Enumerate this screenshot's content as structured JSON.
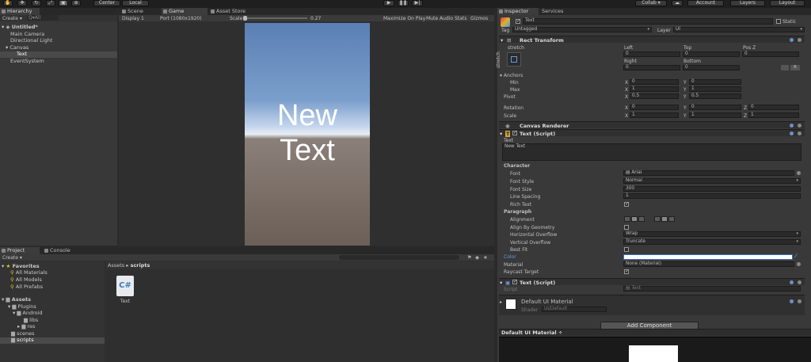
{
  "toolbar": {
    "center": "Center",
    "local": "Local",
    "collab": "Collab ▾",
    "account": "Account",
    "layers": "Layers",
    "layout": "Layout"
  },
  "hierarchy": {
    "tab": "Hierarchy",
    "create": "Create ▾",
    "search": "Q▾All",
    "scene": "Untitled*",
    "items": [
      "Main Camera",
      "Directional Light",
      "Canvas",
      "Text",
      "EventSystem"
    ]
  },
  "game": {
    "tabs": [
      "Scene",
      "Game",
      "Asset Store"
    ],
    "display": "Display 1",
    "resolution": "Port (1080x1920)",
    "scale_label": "Scale",
    "scale_value": "0.27",
    "options": [
      "Maximize On Play",
      "Mute Audio",
      "Stats",
      "Gizmos"
    ],
    "canvas_text_1": "New",
    "canvas_text_2": "Text"
  },
  "project": {
    "tabs": [
      "Project",
      "Console"
    ],
    "create": "Create ▾",
    "favorites": "Favorites",
    "fav_items": [
      "All Materials",
      "All Models",
      "All Prefabs"
    ],
    "assets": "Assets",
    "tree": [
      "Plugins",
      "Android",
      "libs",
      "res",
      "scenes",
      "scripts"
    ],
    "breadcrumb_root": "Assets",
    "breadcrumb_sep": "▸",
    "breadcrumb_current": "scripts",
    "file_name": "Text"
  },
  "inspector": {
    "tabs": [
      "Inspector",
      "Services"
    ],
    "object_name": "Text",
    "static": "Static",
    "tag_label": "Tag",
    "tag_value": "Untagged",
    "layer_label": "Layer",
    "layer_value": "UI",
    "rect_transform": "Rect Transform",
    "stretch": "stretch",
    "stretch_side": "stretch",
    "col_left": "Left",
    "col_top": "Top",
    "col_posz": "Pos Z",
    "left": "0",
    "top": "0",
    "posz": "0",
    "col_right": "Right",
    "col_bottom": "Bottom",
    "right": "0",
    "bottom": "0",
    "r_button": "R",
    "anchors": "Anchors",
    "min": "Min",
    "max": "Max",
    "pivot": "Pivot",
    "min_x": "0",
    "min_y": "0",
    "max_x": "1",
    "max_y": "1",
    "pivot_x": "0.5",
    "pivot_y": "0.5",
    "rotation": "Rotation",
    "rot_x": "0",
    "rot_y": "0",
    "rot_z": "0",
    "scale": "Scale",
    "scale_x": "1",
    "scale_y": "1",
    "scale_z": "1",
    "x": "X",
    "y": "Y",
    "z": "Z",
    "canvas_renderer": "Canvas Renderer",
    "text_script": "Text (Script)",
    "text_label": "Text",
    "text_value": "New Text",
    "character": "Character",
    "font_label": "Font",
    "font_value": "Arial",
    "font_style_label": "Font Style",
    "font_style_value": "Normal",
    "font_size_label": "Font Size",
    "font_size_value": "300",
    "line_spacing_label": "Line Spacing",
    "line_spacing_value": "1",
    "rich_text_label": "Rich Text",
    "paragraph": "Paragraph",
    "alignment_label": "Alignment",
    "align_geo_label": "Align By Geometry",
    "h_overflow_label": "Horizontal Overflow",
    "h_overflow_value": "Wrap",
    "v_overflow_label": "Vertical Overflow",
    "v_overflow_value": "Truncate",
    "best_fit_label": "Best Fit",
    "color_label": "Color",
    "material_label": "Material",
    "material_value": "None (Material)",
    "raycast_label": "Raycast Target",
    "text_script2": "Text (Script)",
    "script_label": "Script",
    "script_value": "Text",
    "default_material": "Default UI Material",
    "shader_label": "Shader",
    "shader_value": "UI/Default",
    "add_component": "Add Component",
    "preview_label": "Default UI Material ÷"
  },
  "colors": {
    "accent": "#3d6fb5",
    "sky_top": "#5a7fb3",
    "ground": "#6b5f57",
    "text_white": "#ffffff"
  }
}
